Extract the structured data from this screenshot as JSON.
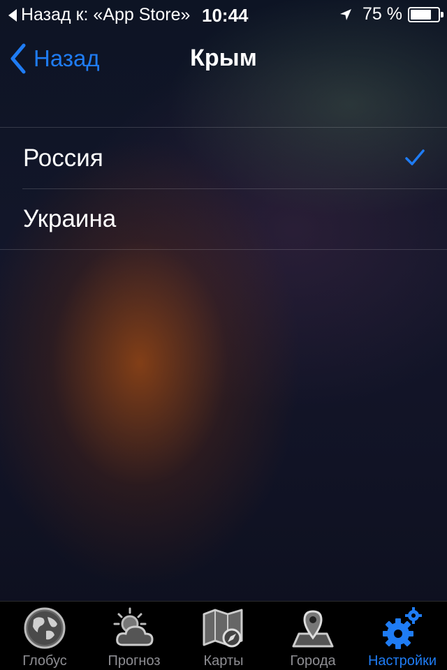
{
  "status_bar": {
    "back_text": "Назад к: «App Store»",
    "time": "10:44",
    "battery_percent_text": "75 %",
    "battery_level": 0.75
  },
  "nav": {
    "back_label": "Назад",
    "title": "Крым"
  },
  "options": [
    {
      "label": "Россия",
      "selected": true
    },
    {
      "label": "Украина",
      "selected": false
    }
  ],
  "tab_bar": {
    "tabs": [
      {
        "label": "Глобус",
        "icon": "globe-icon"
      },
      {
        "label": "Прогноз",
        "icon": "sun-cloud-icon"
      },
      {
        "label": "Карты",
        "icon": "map-compass-icon"
      },
      {
        "label": "Города",
        "icon": "map-pin-icon"
      },
      {
        "label": "Настройки",
        "icon": "gears-icon",
        "active": true
      }
    ]
  },
  "colors": {
    "accent": "#1f7cf4",
    "tab_inactive": "#8e8e93"
  }
}
